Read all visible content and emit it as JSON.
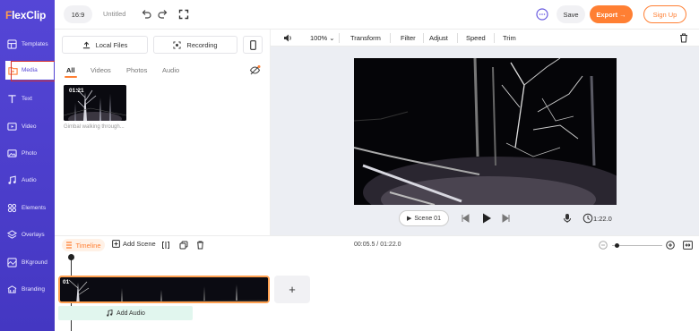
{
  "app": {
    "logo_prefix": "F",
    "logo_rest": "lexClip"
  },
  "sidebar": {
    "items": [
      {
        "label": "Templates",
        "icon": "templates-icon"
      },
      {
        "label": "Media",
        "icon": "media-icon"
      },
      {
        "label": "Text",
        "icon": "text-icon"
      },
      {
        "label": "Video",
        "icon": "video-icon"
      },
      {
        "label": "Photo",
        "icon": "photo-icon"
      },
      {
        "label": "Audio",
        "icon": "audio-icon"
      },
      {
        "label": "Elements",
        "icon": "elements-icon"
      },
      {
        "label": "Overlays",
        "icon": "overlays-icon"
      },
      {
        "label": "BKground",
        "icon": "background-icon"
      },
      {
        "label": "Branding",
        "icon": "branding-icon"
      }
    ],
    "active": "Media"
  },
  "topbar": {
    "ratio": "16:9",
    "title": "Untitled",
    "save": "Save",
    "export": "Export →",
    "signup": "Sign Up"
  },
  "media": {
    "local_files": "Local Files",
    "recording": "Recording",
    "tabs": [
      "All",
      "Videos",
      "Photos",
      "Audio"
    ],
    "active_tab": "All",
    "items": [
      {
        "duration": "01:21",
        "caption": "Gimbal walking through..."
      }
    ]
  },
  "editor": {
    "volume_icon": "volume-icon",
    "zoom": "100%",
    "tools": [
      "Transform",
      "Filter",
      "Adjust",
      "Speed",
      "Trim"
    ],
    "scene": "Scene 01",
    "duration": "1:22.0"
  },
  "timeline": {
    "label": "Timeline",
    "add_scene": "Add Scene",
    "time": "00:05.5 / 01:22.0",
    "zoom_level": 0.05,
    "clip_number": "01",
    "add_audio": "Add Audio"
  },
  "colors": {
    "accent": "#ff7f33",
    "sidebar": "#5546d6",
    "highlight": "#d32f2f"
  }
}
